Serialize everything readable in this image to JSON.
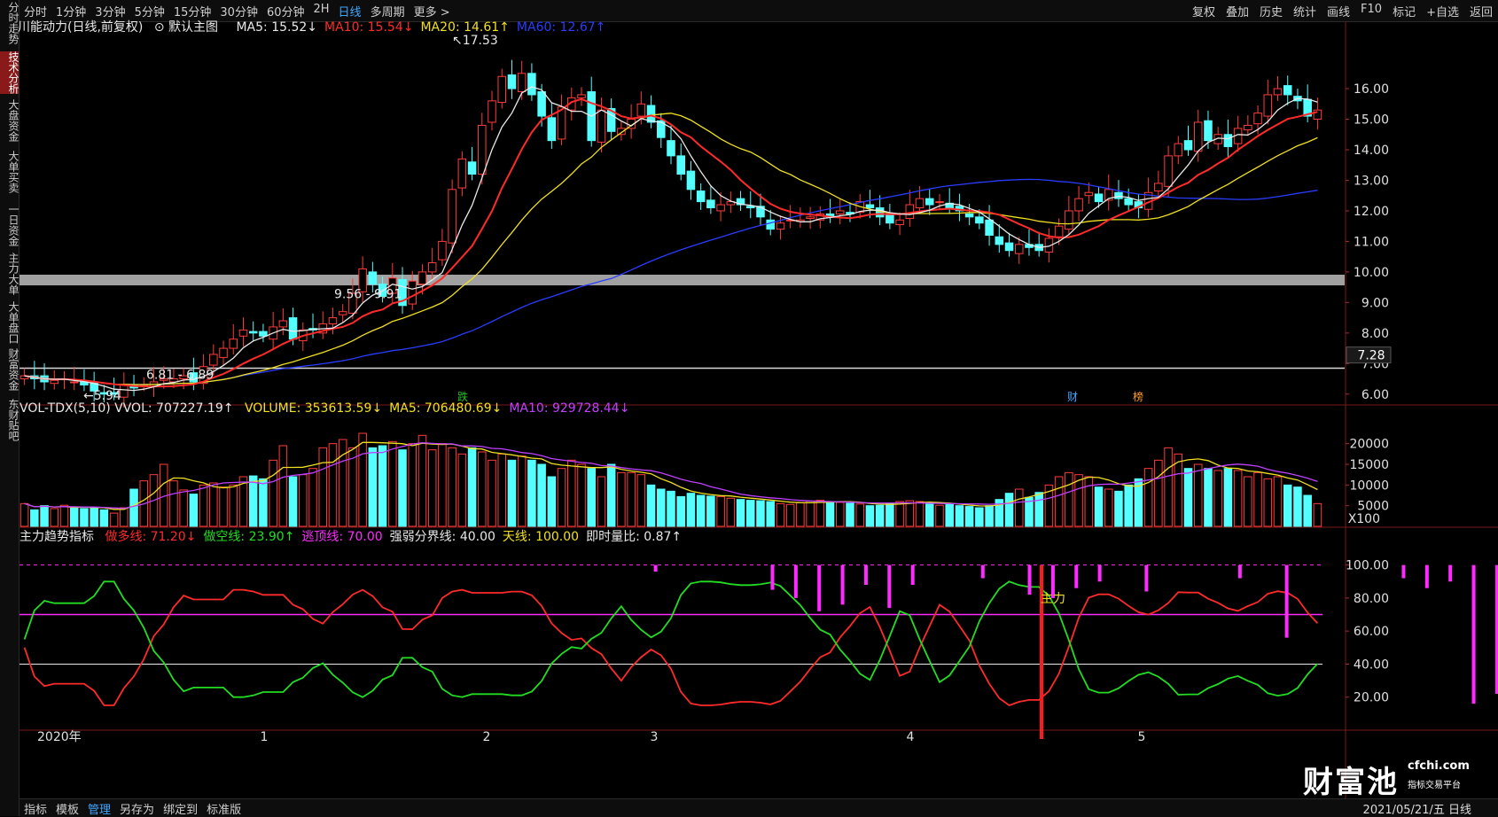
{
  "topbar": {
    "timeframes": [
      "分时",
      "1分钟",
      "3分钟",
      "5分钟",
      "15分钟",
      "30分钟",
      "60分钟",
      "2H",
      "日线",
      "多周期",
      "更多 >"
    ],
    "active": "日线",
    "right_tools": [
      "复权",
      "叠加",
      "历史",
      "统计",
      "画线",
      "F10",
      "标记",
      "+自选",
      "返回"
    ]
  },
  "sidebar": {
    "tabs": [
      "分时走势",
      "技术分析",
      "大盘资金",
      "大单买卖",
      "一日资金",
      "主力大单",
      "大单盘口",
      "财富资金",
      "东财贴吧"
    ],
    "active_index": 1
  },
  "main": {
    "title": "川能动力(日线,前复权)",
    "template": "默认主图",
    "ma": [
      {
        "label": "MA5: 15.52↓",
        "color": "#e8e8e8"
      },
      {
        "label": "MA10: 15.54↓",
        "color": "#ff2a2a"
      },
      {
        "label": "MA20: 14.61↑",
        "color": "#f0e020"
      },
      {
        "label": "MA60: 12.67↑",
        "color": "#2a3cff"
      }
    ],
    "price_ticks": [
      "16.00",
      "15.00",
      "14.00",
      "13.00",
      "12.00",
      "11.00",
      "10.00",
      "9.00",
      "8.00",
      "7.00",
      "6.00"
    ],
    "current_price_tag": "7.28",
    "annotations": {
      "high": "17.53",
      "low": "←5.94",
      "gap1": "9.56 - 9.91",
      "gap2": "6.81 - 6.89"
    },
    "markers": [
      {
        "text": "跌",
        "color": "#22c022"
      },
      {
        "text": "财",
        "color": "#3fa8ff"
      },
      {
        "text": "榜",
        "color": "#ff9a2a"
      }
    ]
  },
  "volume": {
    "title": "VOL-TDX(5,10) VVOL: 707227.19↑",
    "items": [
      {
        "label": "VOLUME: 353613.59↓",
        "color": "#f0e020"
      },
      {
        "label": "MA5: 706480.69↓",
        "color": "#f0e020"
      },
      {
        "label": "MA10: 929728.44↓",
        "color": "#c040ff"
      }
    ],
    "ticks": [
      "20000",
      "15000",
      "10000",
      "5000"
    ],
    "unit": "X100"
  },
  "indicator": {
    "title": "主力趋势指标",
    "items": [
      {
        "label": "做多线: 71.20↓",
        "color": "#ff2a2a"
      },
      {
        "label": "做空线: 23.90↑",
        "color": "#22dd22"
      },
      {
        "label": "逃顶线: 70.00",
        "color": "#ff2aff"
      },
      {
        "label": "强弱分界线: 40.00",
        "color": "#e8e8e8"
      },
      {
        "label": "天线: 100.00",
        "color": "#f0e020"
      },
      {
        "label": "即时量比: 0.87↑",
        "color": "#e8e8e8"
      }
    ],
    "ticks": [
      "100.00",
      "80.00",
      "60.00",
      "40.00",
      "20.00"
    ],
    "signal_label": "主力"
  },
  "xaxis": {
    "labels": [
      "2020年",
      "1",
      "2",
      "3",
      "4",
      "5"
    ]
  },
  "bottombar": {
    "tabs": [
      "指标",
      "模板",
      "管理",
      "另存为",
      "绑定到",
      "标准版"
    ],
    "active": "管理",
    "date": "2021/05/21/五 日线"
  },
  "watermark": {
    "brand": "财富池",
    "site": "cfchi.com",
    "slogan": "指标交易平台"
  },
  "chart_data": {
    "type": "candlestick",
    "security": "川能动力",
    "period": "日线",
    "ylim": [
      5.5,
      17.8
    ],
    "close": [
      6.6,
      6.5,
      6.4,
      6.45,
      6.5,
      6.4,
      6.3,
      6.1,
      6.0,
      6.0,
      6.3,
      6.2,
      6.3,
      6.4,
      6.5,
      6.5,
      6.6,
      6.4,
      6.9,
      7.3,
      7.5,
      7.8,
      8.1,
      8.0,
      7.9,
      8.2,
      8.4,
      7.8,
      8.1,
      8.1,
      8.3,
      8.5,
      8.7,
      9.3,
      10.1,
      9.6,
      9.2,
      9.8,
      8.9,
      9.7,
      10.0,
      10.3,
      11.0,
      12.7,
      13.7,
      13.2,
      14.8,
      15.6,
      16.4,
      16.0,
      16.5,
      15.8,
      15.1,
      14.3,
      15.4,
      15.7,
      15.8,
      14.3,
      15.3,
      14.6,
      14.7,
      15.0,
      15.5,
      14.9,
      14.4,
      13.8,
      13.2,
      12.7,
      12.3,
      12.1,
      12.2,
      12.3,
      12.2,
      12.1,
      11.8,
      11.4,
      11.6,
      11.7,
      11.7,
      11.8,
      11.9,
      11.8,
      12.0,
      11.9,
      12.3,
      12.1,
      11.8,
      11.6,
      11.7,
      12.2,
      12.4,
      12.2,
      12.3,
      12.1,
      12.0,
      11.8,
      11.6,
      11.2,
      10.9,
      10.7,
      10.9,
      10.8,
      10.7,
      11.1,
      11.5,
      12.0,
      12.4,
      12.6,
      12.3,
      12.7,
      12.4,
      12.2,
      12.1,
      12.6,
      12.9,
      13.8,
      14.2,
      14.0,
      14.9,
      14.3,
      14.5,
      14.1,
      14.7,
      14.8,
      15.2,
      15.8,
      16.0,
      15.8,
      15.6,
      15.1,
      15.3
    ],
    "volume": [
      5500,
      4000,
      5000,
      4300,
      5100,
      4500,
      4300,
      4600,
      4000,
      3200,
      4500,
      9000,
      11000,
      12500,
      15000,
      11000,
      8800,
      7800,
      10000,
      10500,
      9500,
      10000,
      12000,
      12200,
      11500,
      16000,
      19500,
      12000,
      12500,
      14000,
      19000,
      20000,
      21000,
      19000,
      22500,
      19000,
      19500,
      20500,
      18500,
      20000,
      22000,
      18500,
      20000,
      19000,
      17500,
      19000,
      18000,
      16000,
      17500,
      16000,
      17000,
      16000,
      15000,
      12000,
      14000,
      16000,
      15000,
      14000,
      12000,
      15000,
      13000,
      13000,
      12500,
      10000,
      9000,
      8500,
      7200,
      8000,
      7500,
      7300,
      7200,
      6800,
      6500,
      6300,
      6200,
      6000,
      5500,
      5300,
      5700,
      6100,
      6300,
      6000,
      5800,
      5600,
      5400,
      5000,
      5100,
      5500,
      6000,
      6200,
      6000,
      5500,
      5100,
      5300,
      5000,
      4800,
      4500,
      5000,
      6500,
      8000,
      9000,
      7000,
      8200,
      10000,
      12000,
      13000,
      12500,
      12000,
      9500,
      9000,
      8500,
      10000,
      11500,
      14000,
      16000,
      19000,
      17500,
      14000,
      15000,
      14000,
      13500,
      14000,
      13500,
      12000,
      13000,
      11500,
      12000,
      10000,
      9500,
      7500,
      5500
    ]
  }
}
